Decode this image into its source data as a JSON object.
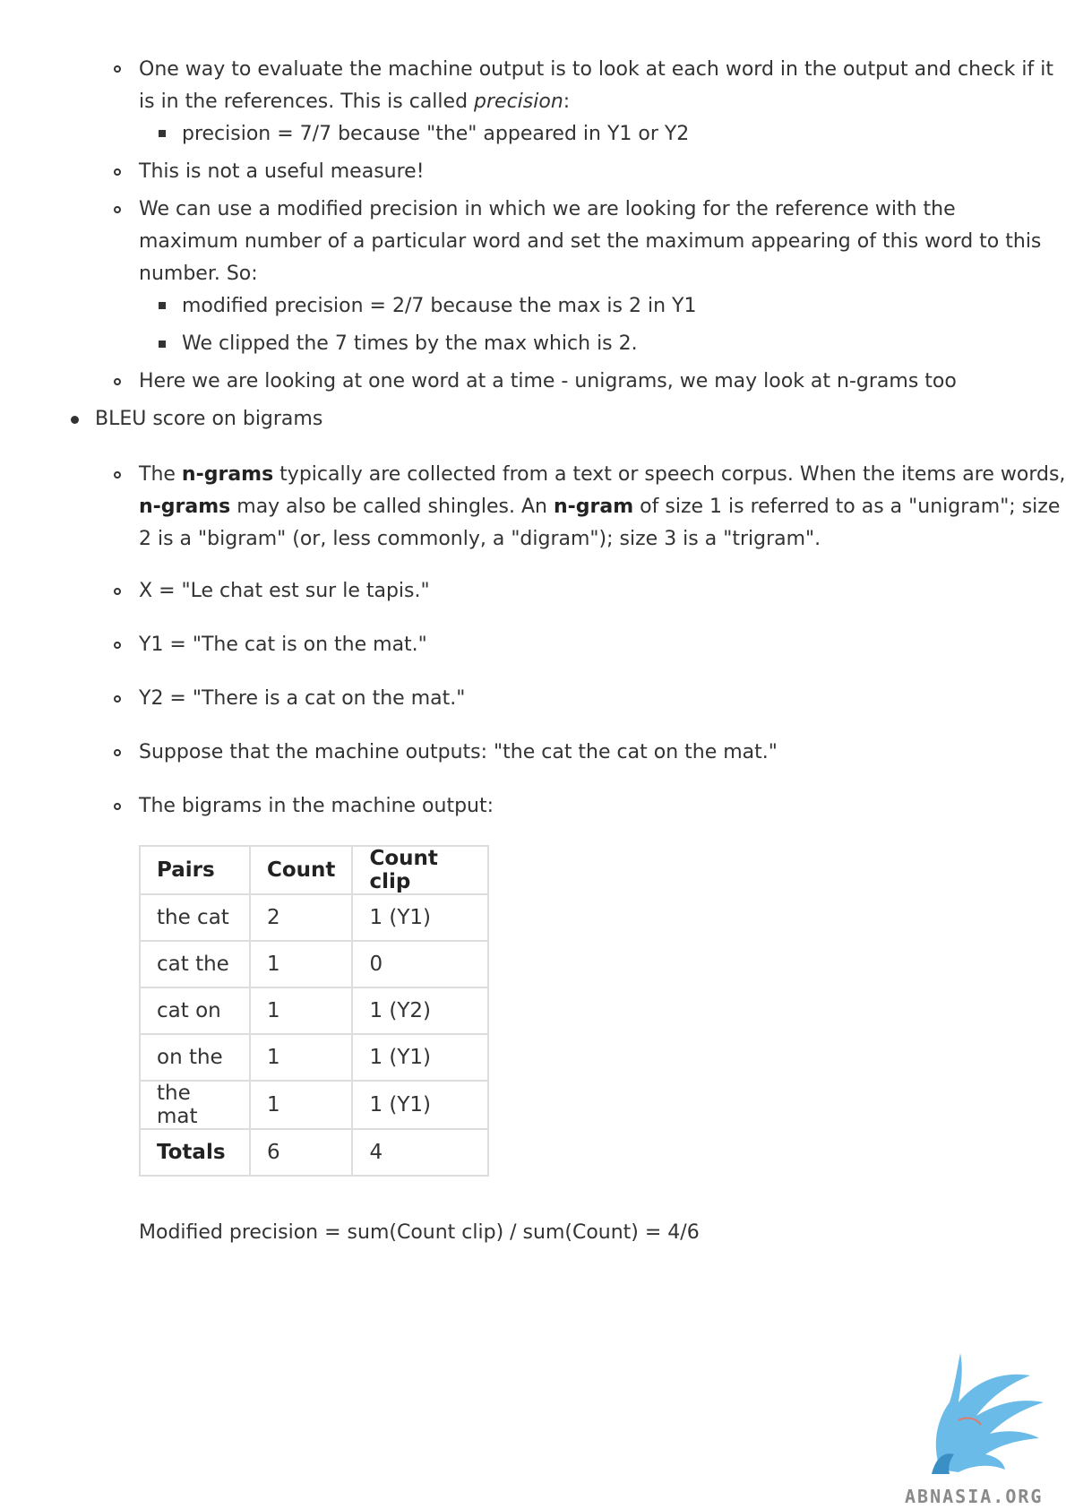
{
  "bullets": {
    "precision_intro_1": "One way to evaluate the machine output is to look at each word in the output and check if it",
    "precision_intro_2a": "is in the references. This is called ",
    "precision_intro_2b": "precision",
    "precision_intro_2c": ":",
    "precision_value": "precision = 7/7 because \"the\" appeared in Y1 or Y2",
    "not_useful": "This is not a useful measure!",
    "modified_intro_1": "We can use a modified precision in which we are looking for the reference with the",
    "modified_intro_2": "maximum number of a particular word and set the maximum appearing of this word to this",
    "modified_intro_3": "number. So:",
    "modified_value": "modified precision = 2/7 because the max is 2 in Y1",
    "clipped": "We clipped the 7 times by the max which is 2.",
    "unigrams_note": "Here we are looking at one word at a time - unigrams, we may look at n-grams too",
    "bleu_bigrams": "BLEU score on bigrams",
    "ngrams_1a": "The ",
    "ngrams_1b": "n-grams",
    "ngrams_1c": " typically are collected from a text or speech corpus. When the items are words,",
    "ngrams_2a": "n-grams",
    "ngrams_2b": " may also be called shingles. An ",
    "ngrams_2c": "n-gram",
    "ngrams_2d": " of size 1 is referred to as a \"unigram\"; size",
    "ngrams_3": "2 is a \"bigram\" (or, less commonly, a \"digram\"); size 3 is a \"trigram\".",
    "x_sentence": "X = \"Le chat est sur le tapis.\"",
    "y1_sentence": "Y1 = \"The cat is on the mat.\"",
    "y2_sentence": "Y2 = \"There is a cat on the mat.\"",
    "machine_output": "Suppose that the machine outputs: \"the cat the cat on the mat.\"",
    "bigrams_intro": "The bigrams in the machine output:"
  },
  "table": {
    "headers": [
      "Pairs",
      "Count",
      "Count clip"
    ],
    "rows": [
      [
        "the cat",
        "2",
        "1 (Y1)"
      ],
      [
        "cat the",
        "1",
        "0"
      ],
      [
        "cat on",
        "1",
        "1 (Y2)"
      ],
      [
        "on the",
        "1",
        "1 (Y1)"
      ],
      [
        "the mat",
        "1",
        "1 (Y1)"
      ],
      [
        "Totals",
        "6",
        "4"
      ]
    ]
  },
  "formula": "Modified precision = sum(Count clip) / sum(Count) = 4/6",
  "watermark": "ABNASIA.ORG",
  "colors": {
    "text": "#333333",
    "table_border": "#dddddd",
    "logo_blue": "#5ab4e6"
  }
}
